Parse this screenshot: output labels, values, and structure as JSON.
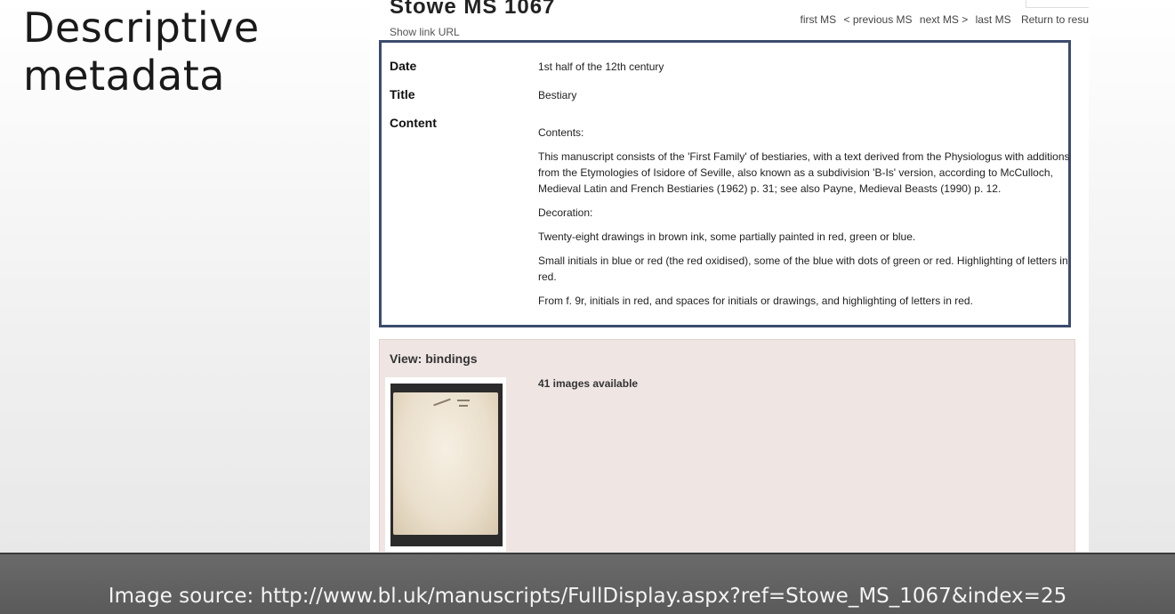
{
  "slide": {
    "title_line1": "Descriptive",
    "title_line2": "metadata",
    "source": "Image source: http://www.bl.uk/manuscripts/FullDisplay.aspx?ref=Stowe_MS_1067&index=25"
  },
  "record": {
    "title": "Stowe MS 1067",
    "show_link": "Show link URL",
    "nav": {
      "first": "first MS",
      "previous": "< previous MS",
      "next": "next MS >",
      "last": "last MS",
      "return": "Return to result"
    },
    "fields": {
      "date_label": "Date",
      "date_value": "1st half of the 12th century",
      "title_label": "Title",
      "title_value": "Bestiary",
      "content_label": "Content",
      "content_paragraphs": [
        "Contents:",
        "This manuscript consists of the 'First Family' of bestiaries, with a text derived from the Physiologus with additions from the Etymologies of Isidore of Seville, also known as a subdivision 'B-Is' version, according to McCulloch, Medieval Latin and French Bestiaries (1962) p. 31; see also Payne, Medieval Beasts (1990) p. 12.",
        "Decoration:",
        "Twenty-eight drawings in brown ink, some partially painted in red, green or blue.",
        "Small initials in blue or red (the red oxidised), some of the blue with dots of green or red. Highlighting of letters in red.",
        "From f. 9r, initials in red, and spaces for initials or drawings, and highlighting of letters in red."
      ]
    },
    "bindings": {
      "heading": "View: bindings",
      "images_available": "41 images available"
    }
  },
  "colors": {
    "highlight_border": "#3c4b6e",
    "bindings_bg": "#efe6e4",
    "footer_bg": "#5f5f5f"
  }
}
